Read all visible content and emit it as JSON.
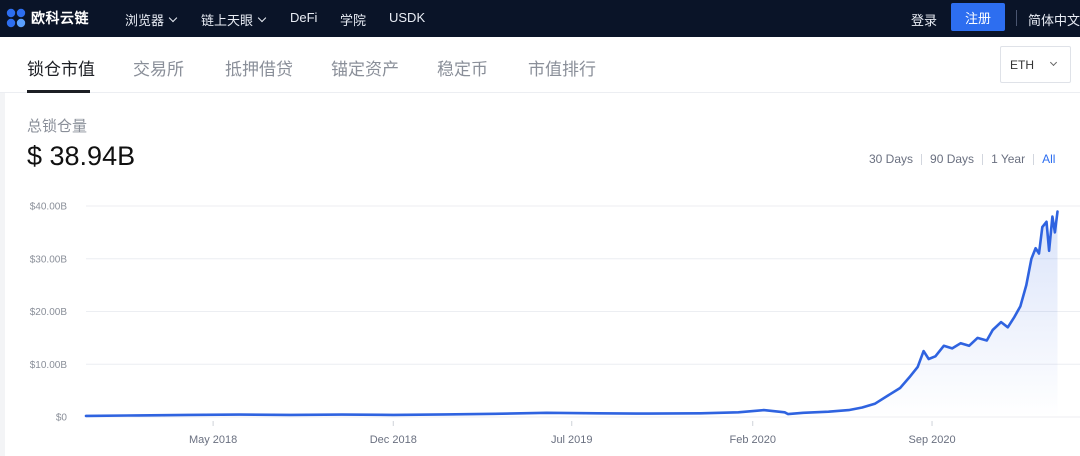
{
  "header": {
    "logo_text": "欧科云链",
    "nav": [
      {
        "label": "浏览器",
        "has_dropdown": true
      },
      {
        "label": "链上天眼",
        "has_dropdown": true
      },
      {
        "label": "DeFi",
        "has_dropdown": false
      },
      {
        "label": "学院",
        "has_dropdown": false
      },
      {
        "label": "USDK",
        "has_dropdown": false
      }
    ],
    "login_label": "登录",
    "register_label": "注册",
    "language_label": "简体中文"
  },
  "tabs": [
    {
      "label": "锁仓市值",
      "active": true
    },
    {
      "label": "交易所",
      "active": false
    },
    {
      "label": "抵押借贷",
      "active": false
    },
    {
      "label": "锚定资产",
      "active": false
    },
    {
      "label": "稳定币",
      "active": false
    },
    {
      "label": "市值排行",
      "active": false
    }
  ],
  "token_select": {
    "value": "ETH"
  },
  "summary": {
    "label": "总锁仓量",
    "value": "$ 38.94B"
  },
  "time_ranges": [
    {
      "label": "30 Days",
      "active": false
    },
    {
      "label": "90 Days",
      "active": false
    },
    {
      "label": "1 Year",
      "active": false
    },
    {
      "label": "All",
      "active": true
    }
  ],
  "colors": {
    "nav_bg": "#0a1428",
    "accent": "#2d6ef0",
    "line": "#2f63e0"
  },
  "chart_data": {
    "type": "line",
    "title": "",
    "xlabel": "",
    "ylabel": "",
    "y_unit": "USD (billions)",
    "ylim": [
      0,
      40
    ],
    "y_ticks": [
      0,
      10,
      20,
      30,
      40
    ],
    "y_tick_labels": [
      "$0",
      "$10.00B",
      "$20.00B",
      "$30.00B",
      "$40.00B"
    ],
    "x_range": [
      "2017-12-01",
      "2021-01-31"
    ],
    "x_ticks": [
      {
        "date": "2018-05-01",
        "label": "May 2018"
      },
      {
        "date": "2018-12-01",
        "label": "Dec 2018"
      },
      {
        "date": "2019-07-01",
        "label": "Jul 2019"
      },
      {
        "date": "2020-02-01",
        "label": "Feb 2020"
      },
      {
        "date": "2020-09-01",
        "label": "Sep 2020"
      }
    ],
    "grid": "horizontal",
    "series": [
      {
        "points": [
          [
            "2017-12-01",
            0.2
          ],
          [
            "2018-02-01",
            0.3
          ],
          [
            "2018-04-01",
            0.4
          ],
          [
            "2018-06-01",
            0.45
          ],
          [
            "2018-08-01",
            0.4
          ],
          [
            "2018-10-01",
            0.45
          ],
          [
            "2018-12-01",
            0.4
          ],
          [
            "2019-02-01",
            0.5
          ],
          [
            "2019-04-01",
            0.6
          ],
          [
            "2019-06-01",
            0.8
          ],
          [
            "2019-08-01",
            0.7
          ],
          [
            "2019-10-01",
            0.65
          ],
          [
            "2019-12-01",
            0.7
          ],
          [
            "2020-01-15",
            0.9
          ],
          [
            "2020-02-14",
            1.3
          ],
          [
            "2020-03-10",
            0.9
          ],
          [
            "2020-03-14",
            0.55
          ],
          [
            "2020-04-01",
            0.8
          ],
          [
            "2020-05-01",
            1.0
          ],
          [
            "2020-05-25",
            1.3
          ],
          [
            "2020-06-10",
            1.8
          ],
          [
            "2020-06-25",
            2.5
          ],
          [
            "2020-07-10",
            4.0
          ],
          [
            "2020-07-25",
            5.5
          ],
          [
            "2020-08-05",
            7.5
          ],
          [
            "2020-08-15",
            9.5
          ],
          [
            "2020-08-22",
            12.5
          ],
          [
            "2020-08-28",
            11.0
          ],
          [
            "2020-09-05",
            11.5
          ],
          [
            "2020-09-15",
            13.5
          ],
          [
            "2020-09-25",
            13.0
          ],
          [
            "2020-10-05",
            14.0
          ],
          [
            "2020-10-15",
            13.5
          ],
          [
            "2020-10-25",
            15.0
          ],
          [
            "2020-11-05",
            14.5
          ],
          [
            "2020-11-12",
            16.5
          ],
          [
            "2020-11-22",
            18.0
          ],
          [
            "2020-11-30",
            17.0
          ],
          [
            "2020-12-08",
            19.0
          ],
          [
            "2020-12-15",
            21.0
          ],
          [
            "2020-12-22",
            25.0
          ],
          [
            "2020-12-28",
            30.0
          ],
          [
            "2021-01-02",
            32.0
          ],
          [
            "2021-01-06",
            31.0
          ],
          [
            "2021-01-10",
            36.0
          ],
          [
            "2021-01-15",
            37.0
          ],
          [
            "2021-01-18",
            31.5
          ],
          [
            "2021-01-22",
            38.0
          ],
          [
            "2021-01-25",
            35.0
          ],
          [
            "2021-01-28",
            38.94
          ]
        ]
      }
    ]
  }
}
